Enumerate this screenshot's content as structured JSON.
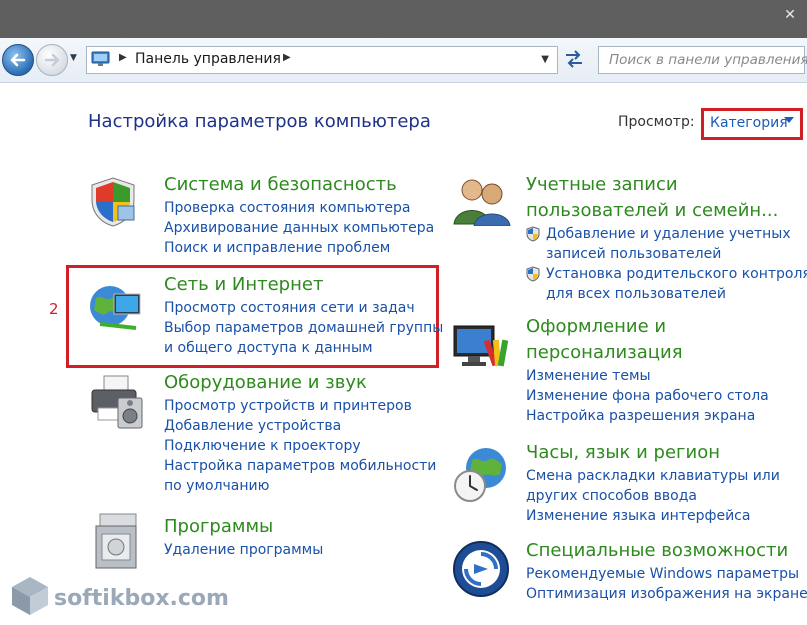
{
  "window": {
    "close_icon": "close-icon"
  },
  "address": {
    "crumb": "Панель управления"
  },
  "search": {
    "placeholder": "Поиск в панели управления"
  },
  "header": {
    "title": "Настройка параметров компьютера"
  },
  "view": {
    "label": "Просмотр:",
    "value": "Категория"
  },
  "annotation": {
    "step": "2",
    "highlight_color": "#d01f26"
  },
  "categories_left": [
    {
      "title": "Система и безопасность",
      "icon": "shield-icon",
      "links": [
        "Проверка состояния компьютера",
        "Архивирование данных компьютера",
        "Поиск и исправление проблем"
      ]
    },
    {
      "title": "Сеть и Интернет",
      "icon": "network-globe-icon",
      "links": [
        "Просмотр состояния сети и задач",
        "Выбор параметров домашней группы",
        "и общего доступа к данным"
      ]
    },
    {
      "title": "Оборудование и звук",
      "icon": "printer-icon",
      "links": [
        "Просмотр устройств и принтеров",
        "Добавление устройства",
        "Подключение к проектору",
        "Настройка параметров мобильности",
        "по умолчанию"
      ]
    },
    {
      "title": "Программы",
      "icon": "programs-icon",
      "links": [
        "Удаление программы"
      ]
    }
  ],
  "categories_right": [
    {
      "title_line1": "Учетные записи",
      "title_line2": "пользователей и семейн...",
      "icon": "users-icon",
      "links": [
        "Добавление и удаление учетных",
        "записей пользователей",
        "Установка родительского контроля",
        "для всех пользователей"
      ]
    },
    {
      "title_line1": "Оформление и",
      "title_line2": "персонализация",
      "icon": "display-palette-icon",
      "links": [
        "Изменение темы",
        "Изменение фона рабочего стола",
        "Настройка разрешения экрана"
      ]
    },
    {
      "title": "Часы, язык и регион",
      "icon": "clock-globe-icon",
      "links": [
        "Смена раскладки клавиатуры или",
        "других способов ввода",
        "Изменение языка интерфейса"
      ]
    },
    {
      "title": "Специальные возможности",
      "icon": "accessibility-icon",
      "links": [
        "Рекомендуемые Windows параметры",
        "Оптимизация изображения на экране"
      ]
    }
  ],
  "watermark": {
    "text": "softikbox.com"
  },
  "colors": {
    "title_green": "#2e8a1e",
    "link_blue": "#1a51a8",
    "heading_blue": "#1e3287",
    "titlebar": "#5f5f5f"
  }
}
